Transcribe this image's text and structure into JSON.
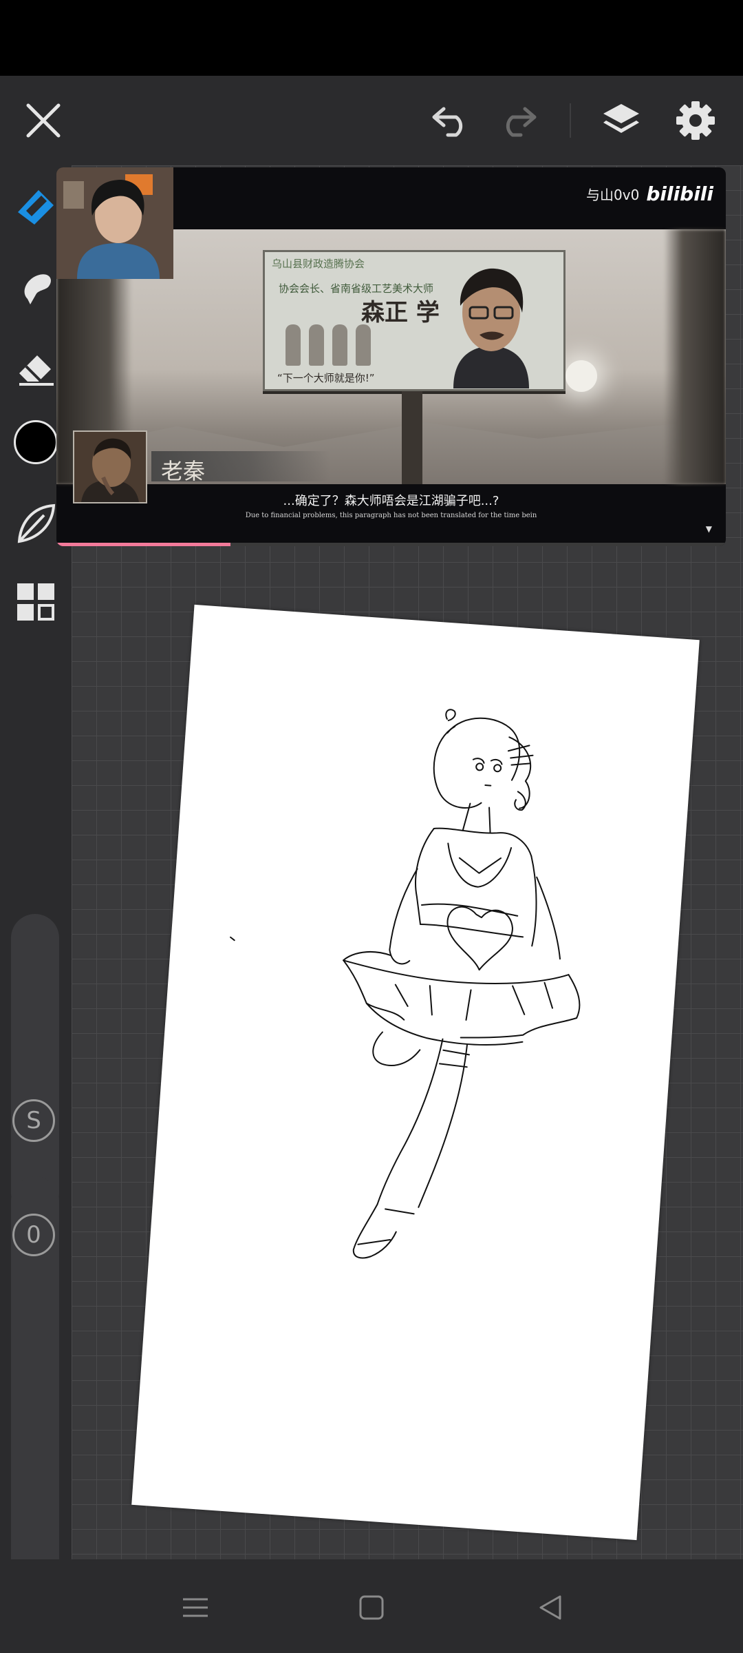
{
  "video": {
    "watermark_user": "与山0v0",
    "watermark_brand": "bilibili",
    "billboard": {
      "org": "乌山县财政造腾协会",
      "line": "协会会长、省南省级工艺美术大师",
      "name": "森正 学",
      "slogan": "“下一个大师就是你!”"
    },
    "speaker": "老秦",
    "subtitle_cn": "...确定了？森大师唔会是江湖骗子吧...?",
    "subtitle_en": "Due to financial problems, this paragraph has not been translated for the time bein",
    "next_marker": "▼",
    "progress": 0.26
  },
  "sidebar": {
    "counter_s": "S",
    "counter_zero": "0"
  },
  "colors": {
    "accent": "#1a8fe3",
    "progress": "#f37a9a",
    "brush_color": "#000000"
  }
}
